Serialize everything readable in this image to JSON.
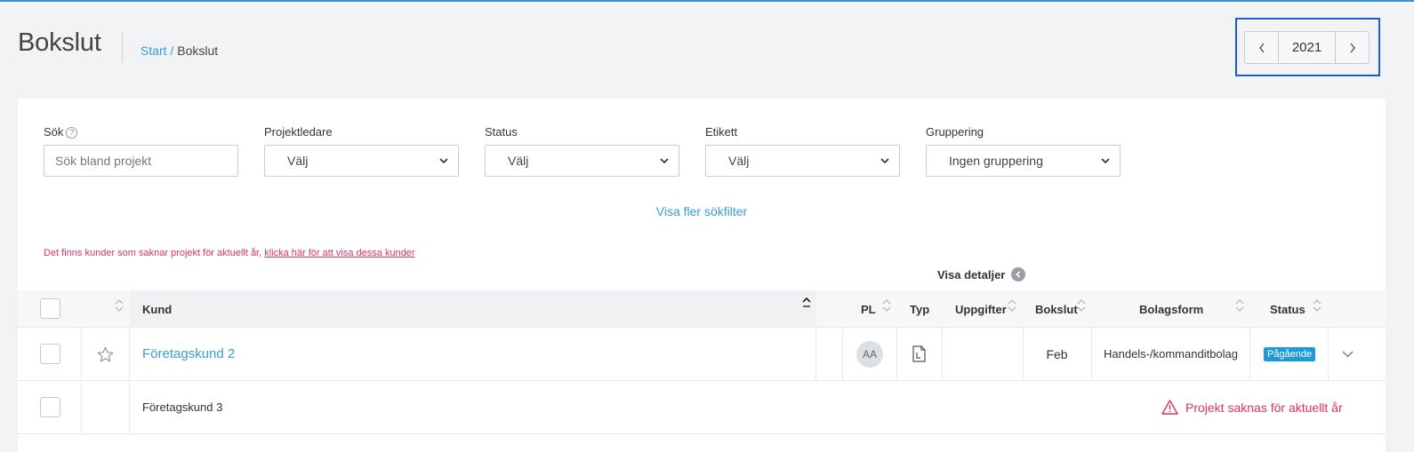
{
  "header": {
    "title": "Bokslut",
    "breadcrumb": {
      "start": "Start",
      "separator": "/",
      "current": "Bokslut"
    },
    "year": "2021"
  },
  "filters": {
    "search": {
      "label": "Sök",
      "placeholder": "Sök bland projekt",
      "help_icon": "?"
    },
    "project_leader": {
      "label": "Projektledare",
      "value": "Välj"
    },
    "status": {
      "label": "Status",
      "value": "Välj"
    },
    "tag": {
      "label": "Etikett",
      "value": "Välj"
    },
    "grouping": {
      "label": "Gruppering",
      "value": "Ingen gruppering"
    },
    "more_filters": "Visa fler sökfilter"
  },
  "notice": {
    "text": "Det finns kunder som saknar projekt för aktuellt år, ",
    "link": "klicka här för att visa dessa kunder"
  },
  "details_toggle": "Visa detaljer",
  "table": {
    "columns": {
      "customer": "Kund",
      "pl": "PL",
      "type": "Typ",
      "tasks": "Uppgifter",
      "closing": "Bokslut",
      "company_form": "Bolagsform",
      "status": "Status"
    },
    "rows": [
      {
        "customer": "Företagskund 2",
        "pl_initials": "AA",
        "type_icon": "document-icon",
        "tasks": "",
        "closing": "Feb",
        "company_form": "Handels-/kommanditbolag",
        "status": "Pågående"
      },
      {
        "customer": "Företagskund 3",
        "warning": "Projekt saknas för aktuellt år"
      }
    ]
  },
  "colors": {
    "accent": "#3a9bd5",
    "warning": "#e0325a",
    "badge": "#1f9ad8",
    "focus": "#1f5bc4"
  }
}
